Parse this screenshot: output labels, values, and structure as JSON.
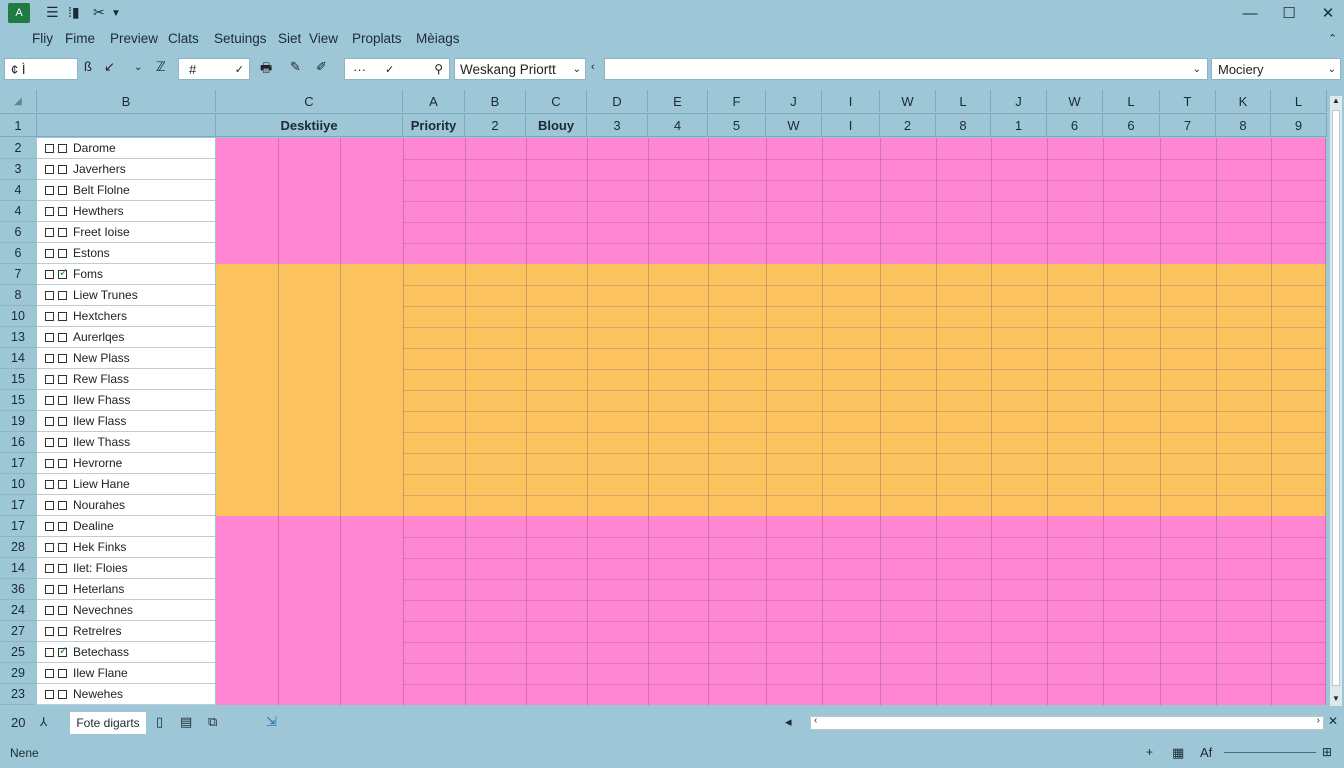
{
  "titlebar": {
    "logo": "A",
    "icons": [
      "hamburger-icon",
      "column-icon",
      "scissors-icon",
      "dropdown-icon"
    ],
    "window_buttons": [
      "minimize-icon",
      "maximize-icon",
      "close-icon"
    ]
  },
  "menu": [
    "Fliy",
    "Fime",
    "Preview",
    "Clats",
    "Setuings",
    "Siet",
    "View",
    "Proplats",
    "Mèiags"
  ],
  "toolbar": {
    "name_box": "¢ Ì",
    "format_box": "#",
    "dots": "···",
    "priority_value": "Weskang Priortt",
    "formula_value": "",
    "right_select": "Mociery"
  },
  "columns": {
    "left_headers": [
      "B",
      "C"
    ],
    "right_headers": [
      "A",
      "B",
      "C",
      "D",
      "E",
      "F",
      "J",
      "I",
      "W",
      "L",
      "J",
      "W",
      "L",
      "T",
      "K",
      "L"
    ],
    "row1_labels": [
      "",
      "Desktiiye",
      "Priority",
      "2",
      "Blouy",
      "3",
      "4",
      "5",
      "W",
      "I",
      "2",
      "8",
      "1",
      "6",
      "6",
      "7",
      "8",
      "9"
    ]
  },
  "rows": [
    {
      "num": "2",
      "label": "Darome",
      "checked": false
    },
    {
      "num": "3",
      "label": "Javerhers",
      "checked": false
    },
    {
      "num": "4",
      "label": "Belt Flolne",
      "checked": false
    },
    {
      "num": "4",
      "label": "Hewthers",
      "checked": false
    },
    {
      "num": "6",
      "label": "Freet Ioise",
      "checked": false
    },
    {
      "num": "6",
      "label": "Estons",
      "checked": false
    },
    {
      "num": "7",
      "label": "Foms",
      "checked": true
    },
    {
      "num": "8",
      "label": "Liew Trunes",
      "checked": false
    },
    {
      "num": "10",
      "label": "Hextchers",
      "checked": false
    },
    {
      "num": "13",
      "label": "Aurerlqes",
      "checked": false
    },
    {
      "num": "14",
      "label": "New Plass",
      "checked": false
    },
    {
      "num": "15",
      "label": "Rew Flass",
      "checked": false
    },
    {
      "num": "15",
      "label": "Ilew Fhass",
      "checked": false
    },
    {
      "num": "19",
      "label": "Ilew Flass",
      "checked": false
    },
    {
      "num": "16",
      "label": "Ilew Thass",
      "checked": false
    },
    {
      "num": "17",
      "label": "Hevrorne",
      "checked": false
    },
    {
      "num": "10",
      "label": "Liew Hane",
      "checked": false
    },
    {
      "num": "17",
      "label": "Nourahes",
      "checked": false
    },
    {
      "num": "17",
      "label": "Dealine",
      "checked": false
    },
    {
      "num": "28",
      "label": "Hek Finks",
      "checked": false
    },
    {
      "num": "14",
      "label": "Ilet: Floies",
      "checked": false
    },
    {
      "num": "36",
      "label": "Heterlans",
      "checked": false
    },
    {
      "num": "24",
      "label": "Nevechnes",
      "checked": false
    },
    {
      "num": "27",
      "label": "Retrelres",
      "checked": false
    },
    {
      "num": "25",
      "label": "Betechass",
      "checked": true
    },
    {
      "num": "29",
      "label": "Ilew Flane",
      "checked": false
    },
    {
      "num": "23",
      "label": "Newehes",
      "checked": false
    }
  ],
  "bands": [
    {
      "color": "#fe86d2",
      "rows": 6
    },
    {
      "color": "#fcc35e",
      "rows": 12
    },
    {
      "color": "#fe86d2",
      "rows": 9
    }
  ],
  "sheetbar": {
    "row_num": "20",
    "tab_label": "Fote digarts"
  },
  "status": {
    "left": "Nene",
    "right": "Af"
  }
}
